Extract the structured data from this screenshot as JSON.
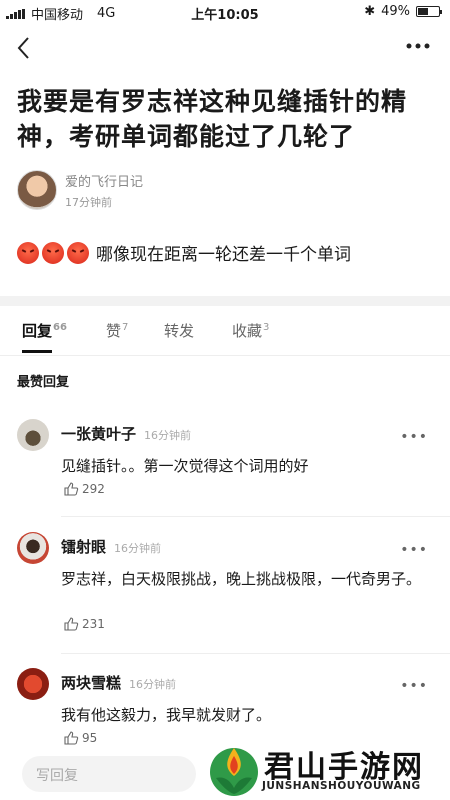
{
  "status_bar": {
    "carrier": "中国移动",
    "network": "4G",
    "time": "上午10:05",
    "battery": "49%",
    "battery_level": 0.49
  },
  "post": {
    "title": "我要是有罗志祥这种见缝插针的精神，考研单词都能过了几轮了",
    "author": "爱的飞行日记",
    "time": "17分钟前",
    "body": "哪像现在距离一轮还差一千个单词"
  },
  "tabs": [
    {
      "label": "回复",
      "count": "66"
    },
    {
      "label": "赞",
      "count": "7"
    },
    {
      "label": "转发",
      "count": ""
    },
    {
      "label": "收藏",
      "count": "3"
    }
  ],
  "section_label": "最赞回复",
  "comments": [
    {
      "name": "一张黄叶子",
      "time": "16分钟前",
      "text": "见缝插针。。第一次觉得这个词用的好",
      "likes": "292"
    },
    {
      "name": "镭射眼",
      "time": "16分钟前",
      "text": "罗志祥，白天极限挑战，晚上挑战极限，一代奇男子。",
      "likes": "231"
    },
    {
      "name": "两块雪糕",
      "time": "16分钟前",
      "text": "我有他这毅力，我早就发财了。",
      "likes": "95"
    }
  ],
  "reply_placeholder": "写回复",
  "watermark": {
    "title": "君山手游网",
    "subtitle": "JUNSHANSHOUYOUWANG"
  }
}
